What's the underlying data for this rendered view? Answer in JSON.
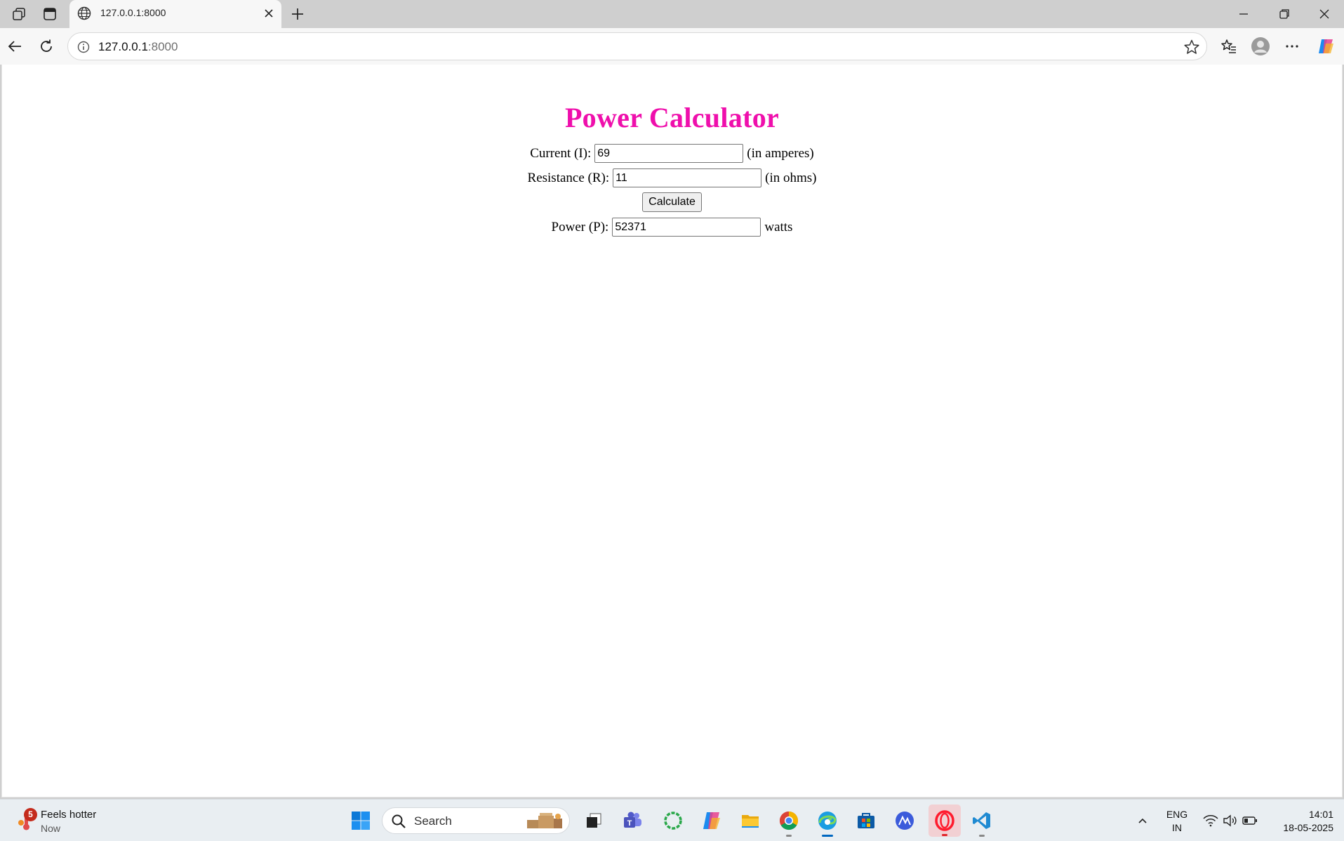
{
  "browser": {
    "tab_title": "127.0.0.1:8000",
    "url_host": "127.0.0.1",
    "url_port": ":8000"
  },
  "page": {
    "heading": "Power Calculator",
    "current_label": "Current (I):",
    "current_value": "69",
    "current_unit": "(in amperes)",
    "resistance_label": "Resistance (R):",
    "resistance_value": "11",
    "resistance_unit": "(in ohms)",
    "calculate_label": "Calculate",
    "power_label": "Power (P):",
    "power_value": "52371",
    "power_unit": "watts"
  },
  "colors": {
    "heading": "#ef0fac",
    "accent": "#0067c0"
  },
  "taskbar": {
    "weather_badge": "5",
    "weather_title": "Feels hotter",
    "weather_subtitle": "Now",
    "search_label": "Search",
    "lang_line1": "ENG",
    "lang_line2": "IN",
    "time": "14:01",
    "date": "18-05-2025"
  }
}
